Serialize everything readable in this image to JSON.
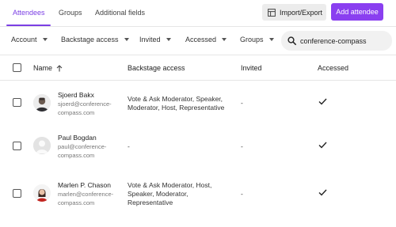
{
  "tabs": [
    {
      "label": "Attendees",
      "active": true
    },
    {
      "label": "Groups",
      "active": false
    },
    {
      "label": "Additional fields",
      "active": false
    }
  ],
  "actions": {
    "import_label": "Import/Export",
    "add_label": "Add attendee"
  },
  "filters": [
    "Account",
    "Backstage access",
    "Invited",
    "Accessed",
    "Groups"
  ],
  "search": {
    "value": "conference-compass"
  },
  "columns": {
    "name": "Name",
    "backstage": "Backstage access",
    "invited": "Invited",
    "accessed": "Accessed"
  },
  "attendees": [
    {
      "name": "Sjoerd Bakx",
      "email_line1": "sjoerd@conference-",
      "email_line2": "compass.com",
      "access_line1": "Vote & Ask Moderator, Speaker,",
      "access_line2": "Moderator, Host, Representative",
      "access_line3": "",
      "invited": "-",
      "accessed": true,
      "avatar": "photo-man"
    },
    {
      "name": "Paul Bogdan",
      "email_line1": "paul@conference-",
      "email_line2": "compass.com",
      "access_line1": "-",
      "access_line2": "",
      "access_line3": "",
      "invited": "-",
      "accessed": true,
      "avatar": "placeholder"
    },
    {
      "name": "Marlen P. Chason",
      "email_line1": "marlen@conference-",
      "email_line2": "compass.com",
      "access_line1": "Vote & Ask Moderator, Host,",
      "access_line2": "Speaker, Moderator,",
      "access_line3": "Representative",
      "invited": "-",
      "accessed": true,
      "avatar": "photo-woman"
    }
  ],
  "colors": {
    "accent": "#7b3fe4",
    "primary_button": "#8a3ff0"
  }
}
